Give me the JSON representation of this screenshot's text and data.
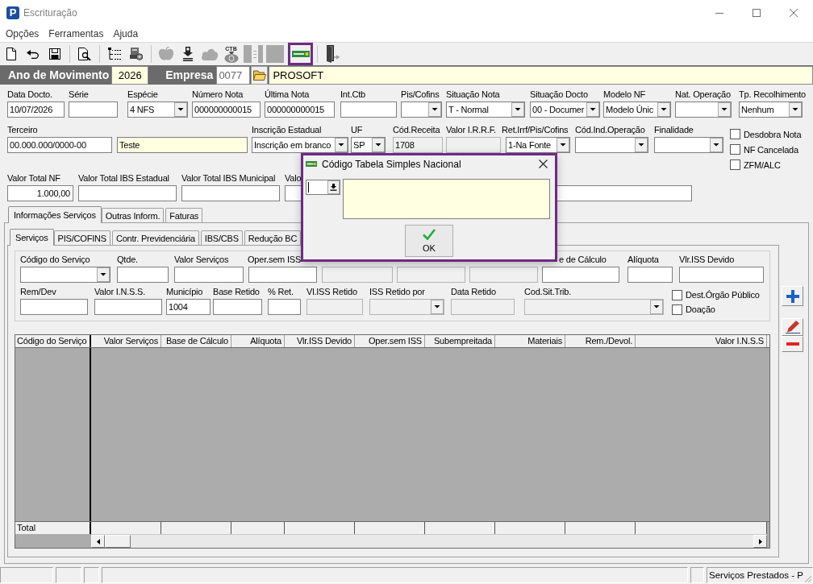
{
  "window": {
    "title": "Escrituração",
    "logo_letter": "P"
  },
  "menu": [
    "Opções",
    "Ferramentas",
    "Ajuda"
  ],
  "toolbar": [
    [
      {
        "kind": "document",
        "disabled": false,
        "selected": false
      },
      {
        "kind": "undo",
        "disabled": false,
        "selected": false
      },
      {
        "kind": "floppy",
        "disabled": false,
        "selected": false
      }
    ],
    [
      {
        "kind": "preview",
        "disabled": false,
        "selected": false
      }
    ],
    [
      {
        "kind": "tree",
        "disabled": false,
        "selected": false
      },
      {
        "kind": "machine",
        "disabled": false,
        "selected": false
      }
    ],
    [
      {
        "kind": "blob",
        "disabled": true,
        "selected": false
      },
      {
        "kind": "download",
        "disabled": false,
        "selected": false
      },
      {
        "kind": "cloud",
        "disabled": true,
        "selected": false
      },
      {
        "kind": "moneybag",
        "text": "CTB",
        "disabled": false,
        "selected": false
      },
      {
        "kind": "panel",
        "disabled": true,
        "selected": false
      },
      {
        "kind": "square",
        "disabled": true,
        "selected": false
      },
      {
        "kind": "card",
        "disabled": false,
        "selected": true
      }
    ],
    [
      {
        "kind": "exit",
        "disabled": false,
        "selected": false
      }
    ]
  ],
  "header": {
    "year_label": "Ano de Movimento",
    "year": "2026",
    "company_label": "Empresa",
    "company_code": "0077",
    "company_name": "PROSOFT"
  },
  "form": {
    "row_1": [
      {
        "label": "Data Docto.",
        "kind": "text",
        "value": "10/07/2026",
        "disabled": false,
        "readonly": false
      },
      {
        "label": "Série",
        "kind": "text",
        "disabled": false,
        "readonly": false
      },
      {
        "label": "Espécie",
        "kind": "select",
        "value": "4 NFS",
        "disabled": false,
        "readonly": false
      },
      {
        "label": "Número Nota",
        "kind": "text",
        "value": "000000000015",
        "disabled": false,
        "readonly": false
      },
      {
        "label": "Última Nota",
        "kind": "text",
        "value": "000000000015",
        "disabled": false,
        "readonly": false
      },
      {
        "label": "Int.Ctb",
        "kind": "text",
        "disabled": false,
        "readonly": false
      },
      {
        "label": "Pis/Cofins",
        "kind": "select",
        "disabled": false,
        "readonly": false
      },
      {
        "label": "Situação Nota",
        "kind": "select",
        "value": "T - Normal",
        "disabled": false,
        "readonly": false
      },
      {
        "label": "Situação Docto",
        "kind": "select",
        "value": "00 - Documer",
        "disabled": false,
        "readonly": false
      },
      {
        "label": "Modelo NF",
        "kind": "select",
        "value": "Modelo Únic",
        "disabled": false,
        "readonly": false
      },
      {
        "label": "Nat. Operação",
        "kind": "select",
        "disabled": false,
        "readonly": false
      },
      {
        "label": "Tp. Recolhimento",
        "kind": "select",
        "value": "Nenhum",
        "disabled": false,
        "readonly": false
      }
    ],
    "row_2": [
      {
        "label": "Terceiro",
        "kind": "text",
        "value": "00.000.000/0000-00",
        "disabled": false,
        "readonly": false
      },
      {
        "kind": "text",
        "value": "Teste",
        "disabled": false,
        "readonly": true
      },
      {
        "label": "Inscrição Estadual",
        "kind": "select",
        "value": "Inscrição em branco",
        "disabled": false,
        "readonly": false
      },
      {
        "label": "UF",
        "kind": "select",
        "value": "SP",
        "disabled": false,
        "readonly": false
      },
      {
        "label": "Cód.Receita",
        "kind": "text",
        "value": "1708",
        "disabled": true,
        "readonly": false
      },
      {
        "label": "Valor I.R.R.F.",
        "kind": "amount",
        "disabled": true,
        "readonly": false
      },
      {
        "label": "Ret.Irrf/Pis/Cofins",
        "kind": "select",
        "value": "1-Na Fonte",
        "disabled": false,
        "readonly": false
      },
      {
        "label": "Cód.Ind.Operação",
        "kind": "select",
        "disabled": false,
        "readonly": false
      },
      {
        "label": "Finalidade",
        "kind": "select",
        "disabled": false,
        "readonly": false
      }
    ],
    "row_3": [
      {
        "label": "Valor Total NF",
        "kind": "amount",
        "value": "1.000,00",
        "disabled": false,
        "readonly": false
      },
      {
        "label": "Valor Total IBS Estadual",
        "kind": "amount",
        "disabled": false,
        "readonly": false
      },
      {
        "label": "Valor Total IBS Municipal",
        "kind": "amount",
        "disabled": false,
        "readonly": false
      },
      {
        "label": "Valo",
        "kind": "amount",
        "disabled": false,
        "readonly": false
      },
      {
        "kind": "amount",
        "disabled": false,
        "readonly": false
      }
    ],
    "flags": [
      {
        "label": "Desdobra Nota",
        "checked": false
      },
      {
        "label": "NF Cancelada",
        "checked": false
      },
      {
        "label": "ZFM/ALC",
        "checked": false
      }
    ]
  },
  "tabs": [
    {
      "label": "Informações Serviços",
      "selected": true
    },
    {
      "label": "Outras Inform.",
      "selected": false
    },
    {
      "label": "Faturas",
      "selected": false
    }
  ],
  "sub_tabs": [
    {
      "label": "Serviços",
      "selected": true
    },
    {
      "label": "PIS/COFINS",
      "selected": false
    },
    {
      "label": "Contr. Previdenciária",
      "selected": false
    },
    {
      "label": "IBS/CBS",
      "selected": false
    },
    {
      "label": "Redução BC",
      "selected": false
    }
  ],
  "services": {
    "row_1": [
      {
        "label": "Código do Serviço",
        "kind": "select",
        "disabled": false,
        "readonly": false
      },
      {
        "label": "Qtde.",
        "kind": "amount",
        "disabled": false,
        "readonly": false
      },
      {
        "label": "Valor Serviços",
        "kind": "amount",
        "disabled": false,
        "readonly": false
      },
      {
        "label": "Oper.sem ISS",
        "kind": "amount",
        "disabled": false,
        "readonly": false
      },
      {
        "kind": "amount",
        "disabled": true,
        "readonly": false
      },
      {
        "kind": "amount",
        "disabled": true,
        "readonly": false
      },
      {
        "kind": "amount",
        "disabled": true,
        "readonly": false
      },
      {
        "label": "e de Cálculo",
        "kind": "amount",
        "disabled": false,
        "readonly": false
      },
      {
        "label": "Alíquota",
        "kind": "amount",
        "disabled": false,
        "readonly": false
      },
      {
        "label": "Vlr.ISS Devido",
        "kind": "amount",
        "disabled": false,
        "readonly": false
      }
    ],
    "row_2": [
      {
        "label": "Rem/Dev",
        "kind": "amount",
        "disabled": false,
        "readonly": false
      },
      {
        "label": "Valor I.N.S.S.",
        "kind": "amount",
        "disabled": false,
        "readonly": false
      },
      {
        "label": "Município",
        "kind": "text",
        "value": "1004",
        "disabled": false,
        "readonly": false
      },
      {
        "label": "Base Retido",
        "kind": "amount",
        "disabled": false,
        "readonly": false
      },
      {
        "label": "% Ret.",
        "kind": "amount",
        "disabled": false,
        "readonly": false
      },
      {
        "label": "Vl.ISS Retido",
        "kind": "amount",
        "disabled": true,
        "readonly": false
      },
      {
        "label": "ISS Retido por",
        "kind": "select",
        "disabled": true,
        "readonly": false
      },
      {
        "label": "Data Retido",
        "kind": "text",
        "disabled": true,
        "readonly": false
      },
      {
        "label": "Cod.Sit.Trib.",
        "kind": "select",
        "disabled": true,
        "readonly": false
      }
    ],
    "flags": [
      {
        "label": "Dest.Órgão Público",
        "checked": false
      },
      {
        "label": "Doação",
        "checked": false
      }
    ]
  },
  "table": {
    "columns": [
      "Código do Serviço",
      "Valor Serviços",
      "Base de Cálculo",
      "Alíquota",
      "Vlr.ISS Devido",
      "Oper.sem ISS",
      "Subempreitada",
      "Materiais",
      "Rem./Devol.",
      "Valor I.N.S.S"
    ],
    "total_label": "Total"
  },
  "dialog": {
    "title": "Código Tabela Simples Nacional",
    "ok_label": "OK"
  },
  "status_bar": {
    "text": "Serviços Prestados - P"
  }
}
